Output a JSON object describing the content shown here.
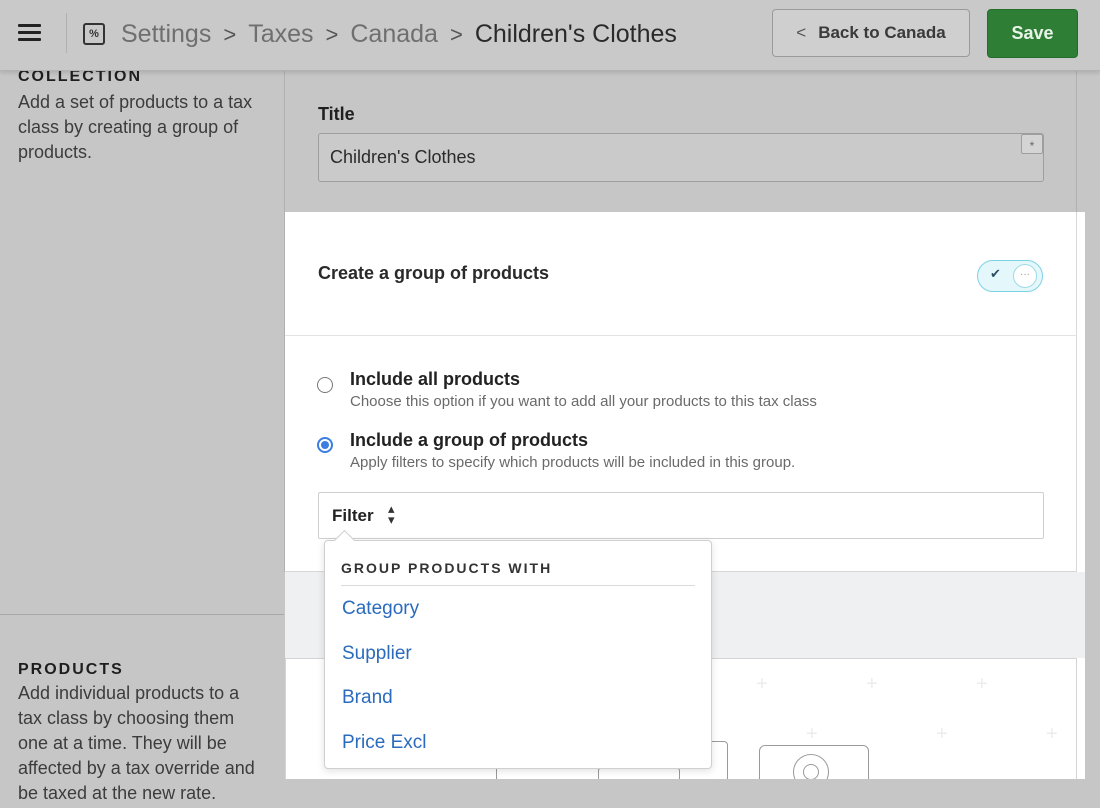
{
  "header": {
    "breadcrumbs": [
      "Settings",
      "Taxes",
      "Canada",
      "Children's Clothes"
    ],
    "back_label": "Back to Canada",
    "save_label": "Save"
  },
  "left": {
    "collection_title": "COLLECTION",
    "collection_desc": "Add a set of products to a tax class by creating a group of products.",
    "products_title": "PRODUCTS",
    "products_desc": "Add individual products to a tax class by choosing them one at a time. They will be affected by a tax override and be taxed at the new rate."
  },
  "form": {
    "title_label": "Title",
    "title_value": "Children's Clothes",
    "required_marker": "*"
  },
  "group": {
    "header": "Create a group of products",
    "toggle_on": true,
    "options": [
      {
        "label": "Include all products",
        "desc": "Choose this option if you want to add all your products to this tax class",
        "selected": false
      },
      {
        "label": "Include a group of products",
        "desc": "Apply filters to specify which products will be included in this group.",
        "selected": true
      }
    ],
    "filter_label": "Filter"
  },
  "dropdown": {
    "header": "GROUP PRODUCTS WITH",
    "items": [
      "Category",
      "Supplier",
      "Brand",
      "Price Excl"
    ]
  },
  "colors": {
    "save": "#2f7e36",
    "link": "#2a6bbd",
    "radio_active": "#3b7de0",
    "toggle": "#7fd1e4"
  }
}
